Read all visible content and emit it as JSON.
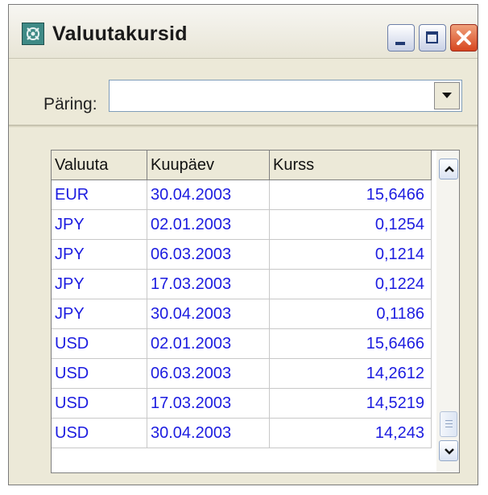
{
  "window": {
    "title": "Valuutakursid",
    "icon": "exchange-icon",
    "controls": {
      "minimize": "minimize-icon",
      "maximize": "maximize-icon",
      "close": "close-icon"
    }
  },
  "query": {
    "label": "Päring:",
    "value": "",
    "dropdown_icon": "chevron-down-icon"
  },
  "table": {
    "columns": [
      "Valuuta",
      "Kuupäev",
      "Kurss"
    ],
    "rows": [
      [
        "EUR",
        "30.04.2003",
        "15,6466"
      ],
      [
        "JPY",
        "02.01.2003",
        "0,1254"
      ],
      [
        "JPY",
        "06.03.2003",
        "0,1214"
      ],
      [
        "JPY",
        "17.03.2003",
        "0,1224"
      ],
      [
        "JPY",
        "30.04.2003",
        "0,1186"
      ],
      [
        "USD",
        "02.01.2003",
        "15,6466"
      ],
      [
        "USD",
        "06.03.2003",
        "14,2612"
      ],
      [
        "USD",
        "17.03.2003",
        "14,5219"
      ],
      [
        "USD",
        "30.04.2003",
        "14,243"
      ]
    ],
    "value_color": "#1c1ce0"
  },
  "scrollbar": {
    "up_icon": "chevron-up-icon",
    "down_icon": "chevron-down-icon"
  }
}
